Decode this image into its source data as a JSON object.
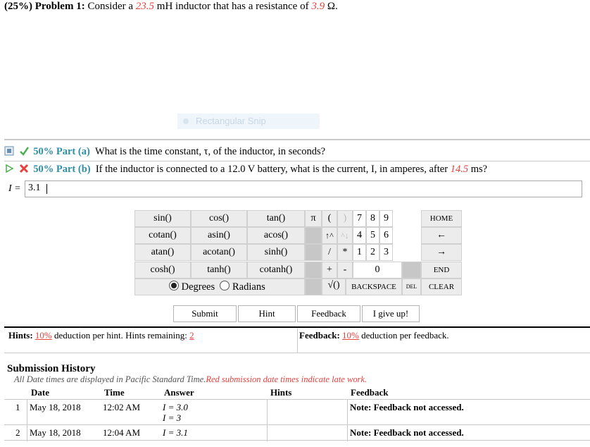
{
  "problem": {
    "weight": "(25%)",
    "label": "Problem 1:",
    "text_before": "Consider a",
    "inductance": "23.5",
    "text_mid": "mH inductor that has a resistance of",
    "resistance": "3.9",
    "unit": "Ω."
  },
  "snip_overlay": "Rectangular Snip",
  "part_a": {
    "title": "50% Part (a)",
    "question": "What is the time constant, τ, of the inductor, in seconds?"
  },
  "part_b": {
    "title": "50% Part (b)",
    "question_before": "If the inductor is connected to a 12.0 V battery, what is the current, I, in amperes, after",
    "time": "14.5",
    "question_after": "ms?"
  },
  "answer": {
    "label": "I =",
    "value": "3.1"
  },
  "keypad": {
    "functions": [
      "sin()",
      "cos()",
      "tan()",
      "cotan()",
      "asin()",
      "acos()",
      "atan()",
      "acotan()",
      "sinh()",
      "cosh()",
      "tanh()",
      "cotanh()"
    ],
    "symbols": [
      "π",
      "(",
      ")",
      "↑^",
      "^↓",
      "/",
      "*",
      "+",
      "-",
      "√()",
      ""
    ],
    "digits": [
      "7",
      "8",
      "9",
      "4",
      "5",
      "6",
      "1",
      "2",
      "3",
      "0"
    ],
    "nav": [
      "HOME",
      "←",
      "→",
      "END",
      "CLEAR"
    ],
    "backspace": "BACKSPACE",
    "del": "DEL",
    "degrees": "Degrees",
    "radians": "Radians"
  },
  "buttons": {
    "submit": "Submit",
    "hint": "Hint",
    "feedback": "Feedback",
    "give_up": "I give up!"
  },
  "hints": {
    "label": "Hints:",
    "pct": "10%",
    "text": "deduction per hint. Hints remaining:",
    "remaining": "2"
  },
  "feedback": {
    "label": "Feedback:",
    "pct": "10%",
    "text": "deduction per feedback."
  },
  "history": {
    "title": "Submission History",
    "note": "All Date times are displayed in Pacific Standard Time.",
    "note_red": "Red submission date times indicate late work.",
    "headers": [
      "Date",
      "Time",
      "Answer",
      "Hints",
      "Feedback"
    ],
    "rows": [
      {
        "num": "1",
        "date": "May 18, 2018",
        "time": "12:02 AM",
        "answer1": "I = 3.0",
        "answer2": "I = 3",
        "feedback": "Note: Feedback not accessed."
      },
      {
        "num": "2",
        "date": "May 18, 2018",
        "time": "12:04 AM",
        "answer1": "I = 3.1",
        "feedback": "Note: Feedback not accessed."
      }
    ]
  },
  "colors": {
    "accent": "#2e8fa8",
    "highlight": "#e8403c"
  }
}
